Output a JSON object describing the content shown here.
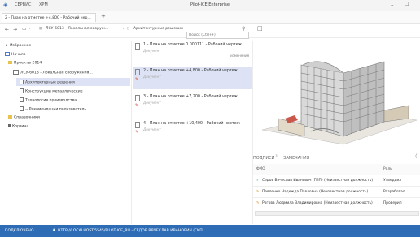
{
  "menu": {
    "service": "СЕРВИС",
    "xpm": "XPM"
  },
  "app_title": "Pilot-ICE Enterprise",
  "tab": {
    "label": "2 - План на отметке +4,800 - Рабочий чер...",
    "add": "+"
  },
  "breadcrumb": {
    "part1": "ЛСУ-6013 - Локальная сооруж...",
    "part2": "Архитектурные решения",
    "search_placeholder": "Поиск (Ctrl+F)"
  },
  "tree": [
    {
      "label": "Избранное",
      "icon": "star-icon"
    },
    {
      "label": "Начало",
      "icon": "home-icon"
    },
    {
      "label": "Проекты 2014",
      "icon": "folder-icon"
    },
    {
      "label": "ЛСУ-6013 - Локальная сооружения...",
      "icon": "project-icon"
    },
    {
      "label": "Архитектурные решения",
      "icon": "doc-icon"
    },
    {
      "label": "Конструкции металлические",
      "icon": "doc-icon"
    },
    {
      "label": "Технология производства",
      "icon": "doc-icon"
    },
    {
      "label": "-- Рекомендации пользователь...",
      "icon": "doc-icon"
    },
    {
      "label": "Справочники",
      "icon": "folder-icon"
    },
    {
      "label": "Корзина",
      "icon": "trash-icon"
    }
  ],
  "documents": [
    {
      "title": "1 - План на отметке 0.000111 - Рабочий чертеж",
      "subtitle": "Документ",
      "badge": "изменения"
    },
    {
      "title": "2 - План на отметке +4,800 - Рабочий чертеж",
      "subtitle": "Документ",
      "badge": ""
    },
    {
      "title": "3 - План на отметке +7,200 - Рабочий чертеж",
      "subtitle": "Документ",
      "badge": ""
    },
    {
      "title": "4 - План на отметке +10,400 - Рабочий чертеж",
      "subtitle": "Документ",
      "badge": ""
    }
  ],
  "panel": {
    "tab1": "ПОДПИСИ",
    "tab1_count": "3",
    "tab2": "ЗАМЕЧАНИЯ",
    "col_fio": "ФИО",
    "col_role": "Роль",
    "rows": [
      {
        "name": "Седов Вячеслав Иванович (ГИП) (Неизвестная должность)",
        "role": "Утвердил",
        "icon": "check-icon"
      },
      {
        "name": "Павленко Надежда Павловна (Неизвестная должность)",
        "role": "Разработал",
        "icon": "pen-icon"
      },
      {
        "name": "Рогова Людмила Владимировна (Неизвестная должность)",
        "role": "Проверил",
        "icon": "pen-icon"
      }
    ]
  },
  "status": {
    "state": "ПОДКЛЮЧЕНО",
    "user": "HTTP://LOCALHOST:5545/PILOT-ICE_RU - СЕДОВ ВЯЧЕСЛАВ ИВАНОВИЧ (ГИП)"
  },
  "colors": {
    "accent": "#2e6db5",
    "selection": "#dde3f4",
    "folder": "#e8c24a"
  }
}
